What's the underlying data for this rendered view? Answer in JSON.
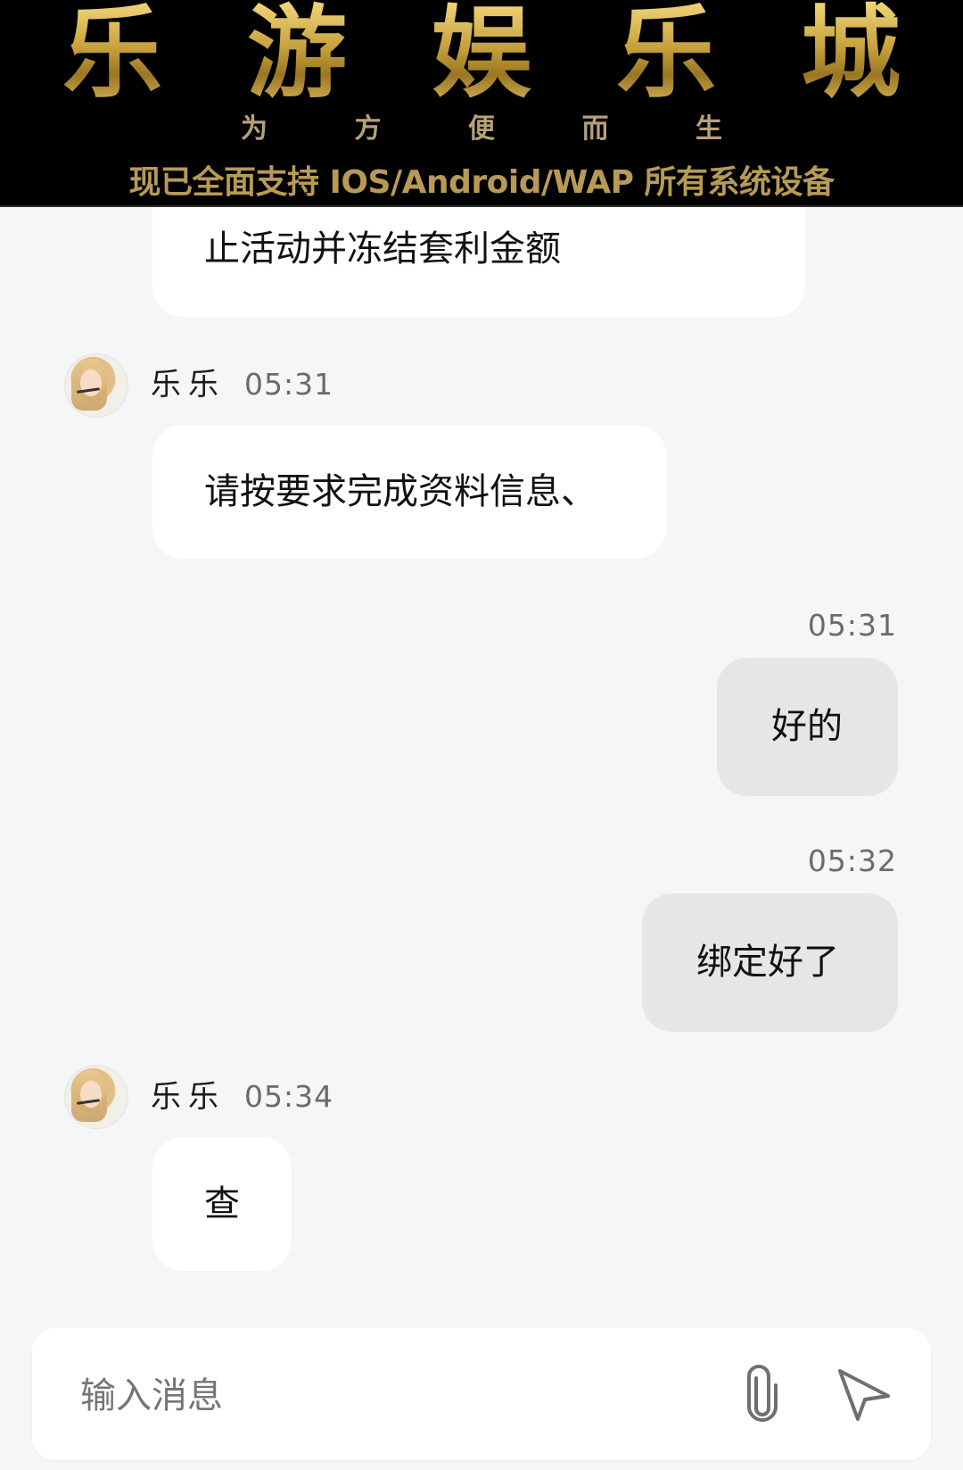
{
  "banner": {
    "title_chars": [
      "乐",
      "游",
      "娱",
      "乐",
      "城"
    ],
    "subtitle_chars": [
      "为",
      "方",
      "便",
      "而",
      "生"
    ],
    "tagline": "现已全面支持 IOS/Android/WAP 所有系统设备"
  },
  "messages": [
    {
      "id": "m0",
      "from": "agent",
      "text_partial_line": "止活动并冻结套利金额"
    },
    {
      "id": "m1",
      "from": "agent",
      "sender": "乐乐",
      "time": "05:31",
      "text": "请按要求完成资料信息、"
    },
    {
      "id": "m2",
      "from": "self",
      "time": "05:31",
      "text": "好的"
    },
    {
      "id": "m3",
      "from": "self",
      "time": "05:32",
      "text": "绑定好了"
    },
    {
      "id": "m4",
      "from": "agent",
      "sender": "乐乐",
      "time": "05:34",
      "text": "查"
    }
  ],
  "input": {
    "placeholder": "输入消息"
  },
  "icons": {
    "attach": "paperclip-icon",
    "send": "send-icon"
  }
}
